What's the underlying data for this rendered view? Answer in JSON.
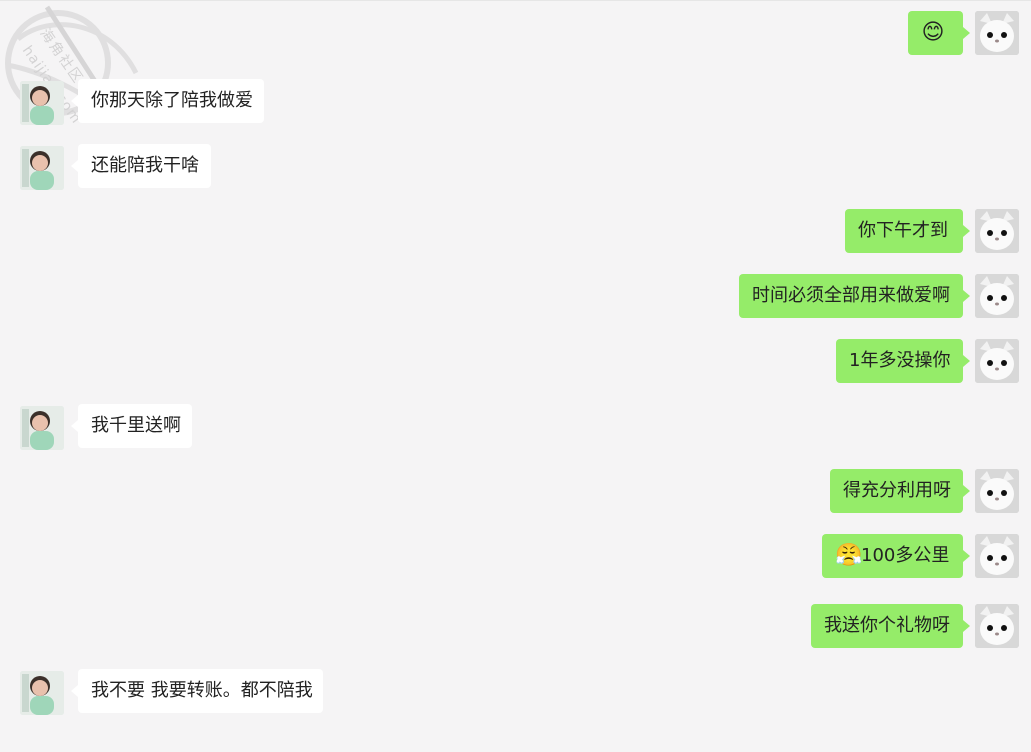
{
  "watermark": {
    "line1": "海角社区",
    "line2": "haijiao.com"
  },
  "messages": [
    {
      "side": "right",
      "emoji": "😊",
      "text": ""
    },
    {
      "side": "left",
      "text": "你那天除了陪我做爱"
    },
    {
      "side": "left",
      "text": "还能陪我干啥"
    },
    {
      "side": "right",
      "text": "你下午才到"
    },
    {
      "side": "right",
      "text": "时间必须全部用来做爱啊"
    },
    {
      "side": "right",
      "text": "1年多没操你"
    },
    {
      "side": "left",
      "text": "我千里送啊"
    },
    {
      "side": "right",
      "text": "得充分利用呀"
    },
    {
      "side": "right",
      "emoji": "😤",
      "text": "100多公里"
    },
    {
      "side": "right",
      "text": "我送你个礼物呀"
    },
    {
      "side": "left",
      "text": "我不要 我要转账。都不陪我"
    }
  ],
  "colors": {
    "background": "#f5f4f5",
    "incoming_bubble": "#ffffff",
    "outgoing_bubble": "#95ec69"
  },
  "avatars": {
    "left": "girl-avatar",
    "right": "cat-avatar"
  }
}
